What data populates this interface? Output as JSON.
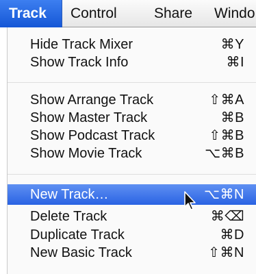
{
  "menubar": {
    "items": [
      {
        "label": "Track",
        "active": true
      },
      {
        "label": "Control",
        "active": false
      },
      {
        "label": "Share",
        "active": false
      },
      {
        "label": "Windo",
        "active": false
      }
    ]
  },
  "menu": {
    "groups": [
      [
        {
          "label": "Hide Track Mixer",
          "shortcut": "⌘Y"
        },
        {
          "label": "Show Track Info",
          "shortcut": "⌘I"
        }
      ],
      [
        {
          "label": "Show Arrange Track",
          "shortcut": "⇧⌘A"
        },
        {
          "label": "Show Master Track",
          "shortcut": "⌘B"
        },
        {
          "label": "Show Podcast Track",
          "shortcut": "⇧⌘B"
        },
        {
          "label": "Show Movie Track",
          "shortcut": "⌥⌘B"
        }
      ],
      [
        {
          "label": "New Track…",
          "shortcut": "⌥⌘N",
          "highlighted": true
        },
        {
          "label": "Delete Track",
          "shortcut": "⌘⌫"
        },
        {
          "label": "Duplicate Track",
          "shortcut": "⌘D"
        },
        {
          "label": "New Basic Track",
          "shortcut": "⇧⌘N"
        }
      ]
    ]
  },
  "colors": {
    "accent": "#2a63e3",
    "menubar_active": "#1557d6"
  },
  "icons": {
    "cursor": "arrow-pointer-icon"
  }
}
